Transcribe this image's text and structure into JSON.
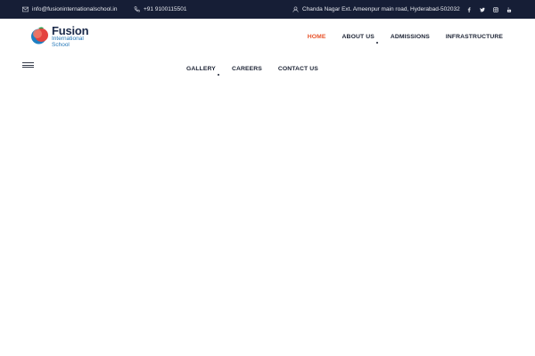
{
  "topbar": {
    "email": "info@fusioninternationalschool.in",
    "phone": "+91 9100115501",
    "address": "Chanda Nagar Ext. Ameenpur main road, Hyderabad-502032",
    "socials": [
      "facebook-icon",
      "twitter-icon",
      "instagram-icon",
      "youtube-icon"
    ]
  },
  "logo": {
    "name": "Fusion",
    "line1": "International",
    "line2": "School"
  },
  "nav": {
    "home": "HOME",
    "about": "ABOUT US",
    "admissions": "ADMISSIONS",
    "infrastructure": "INFRASTRUCTURE",
    "gallery": "GALLERY",
    "careers": "CAREERS",
    "contact": "CONTACT US"
  },
  "colors": {
    "topbar_bg": "#161e36",
    "accent": "#e8532a",
    "nav_text": "#1b2233"
  }
}
